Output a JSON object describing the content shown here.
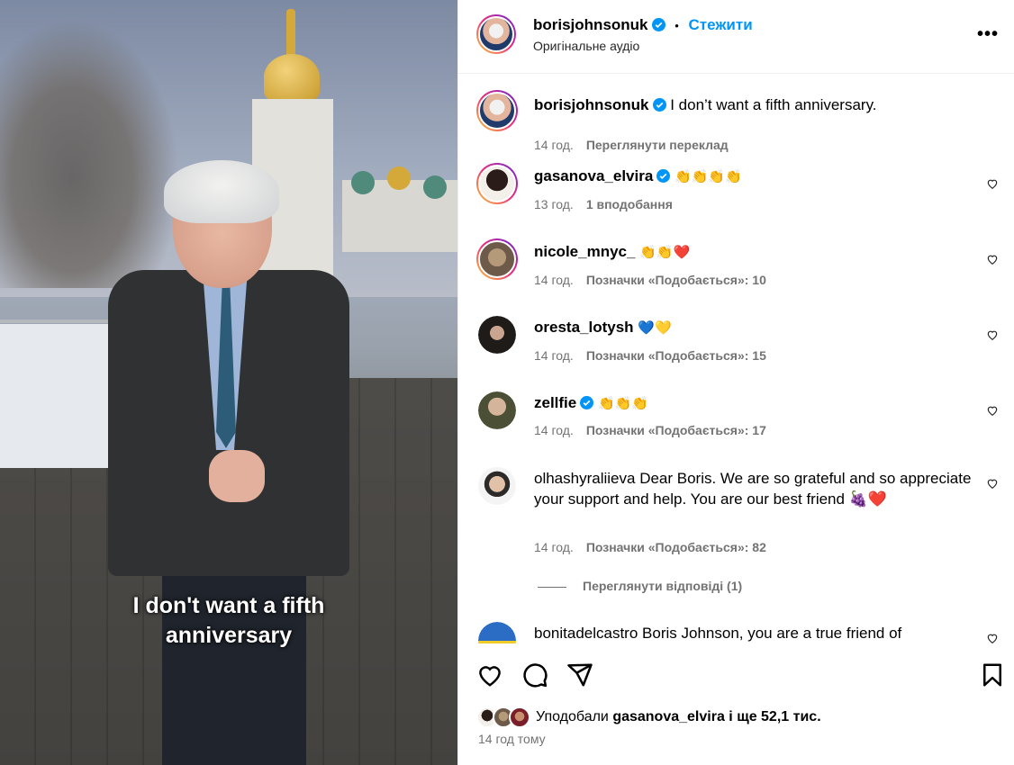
{
  "video": {
    "caption_line1": "I don't want a fifth",
    "caption_line2": "anniversary"
  },
  "header": {
    "username": "borisjohnsonuk",
    "separator": "•",
    "follow_label": "Стежити",
    "audio_label": "Оригінальне аудіо",
    "more_label": "•••"
  },
  "caption": {
    "username": "borisjohnsonuk",
    "text": "I don’t want a fifth anniversary.",
    "time": "14 год.",
    "translate_label": "Переглянути переклад"
  },
  "comments": [
    {
      "username": "gasanova_elvira",
      "verified": true,
      "text": "👏👏👏👏",
      "time": "13 год.",
      "likes_label": "1 вподобання"
    },
    {
      "username": "nicole_mnyc_",
      "verified": false,
      "text": "👏👏❤️",
      "time": "14 год.",
      "likes_label": "Позначки «Подобається»: 10"
    },
    {
      "username": "oresta_lotysh",
      "verified": false,
      "text": "💙💛",
      "time": "14 год.",
      "likes_label": "Позначки «Подобається»: 15"
    },
    {
      "username": "zellfie",
      "verified": true,
      "text": "👏👏👏",
      "time": "14 год.",
      "likes_label": "Позначки «Подобається»: 17"
    },
    {
      "username": "olhashyraliieva",
      "verified": false,
      "text": "Dear Boris. We are so grateful and so appreciate your support and help. You are our best friend 🍇❤️",
      "time": "14 год.",
      "likes_label": "Позначки «Подобається»: 82"
    },
    {
      "username": "bonitadelcastro",
      "verified": false,
      "text": "Boris Johnson, you are a true friend of",
      "time": "",
      "likes_label": ""
    }
  ],
  "view_replies_label": "Переглянути відповіді (1)",
  "likes": {
    "prefix": "Уподобали",
    "user": "gasanova_elvira",
    "suffix": "і ще 52,1 тис."
  },
  "timestamp": "14 год тому",
  "colors": {
    "accent": "#0095f6",
    "verified": "#0095f6",
    "secondary_text": "#737373",
    "divider": "#efefef"
  },
  "icons": [
    "like-icon",
    "comment-icon",
    "share-icon",
    "save-icon",
    "more-icon",
    "heart-icon",
    "verified-icon"
  ]
}
